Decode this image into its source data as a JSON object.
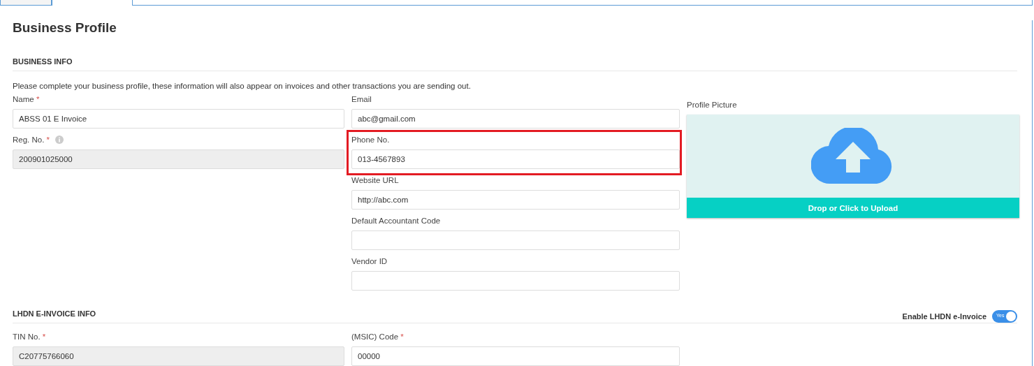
{
  "tabs": [
    {
      "selected": false
    },
    {
      "selected": true
    }
  ],
  "title": "Business Profile",
  "business_info": {
    "heading": "BUSINESS INFO",
    "description": "Please complete your business profile, these information will also appear on invoices and other transactions you are sending out.",
    "columns": [
      [
        {
          "label": "Name",
          "required_mark": "*",
          "value": "ABSS 01 E Invoice",
          "disabled": false
        },
        {
          "label": "Reg. No.",
          "required_mark": "*",
          "info": true,
          "value": "200901025000",
          "disabled": true
        }
      ],
      [
        {
          "label": "Email",
          "value": "abc@gmail.com",
          "disabled": false
        },
        {
          "label": "Phone No.",
          "value": "013-4567893",
          "disabled": false,
          "highlighted": true
        },
        {
          "label": "Website URL",
          "value": "http://abc.com",
          "disabled": false
        },
        {
          "label": "Default Accountant Code",
          "disabled": false
        },
        {
          "label": "Vendor ID",
          "disabled": false
        }
      ]
    ],
    "profile_picture": {
      "label": "Profile Picture",
      "upload_label": "Drop or Click to Upload"
    }
  },
  "lhdn_info": {
    "heading": "LHDN E-INVOICE INFO",
    "toggle": {
      "label": "Enable LHDN e-Invoice",
      "on": true,
      "state_text": "Yes"
    },
    "columns": [
      [
        {
          "label": "TIN No.",
          "required_mark": "*",
          "value": "C20775766060",
          "disabled": true
        }
      ],
      [
        {
          "label": "(MSIC) Code",
          "required_mark": "*",
          "value": "00000",
          "disabled": false
        }
      ]
    ]
  }
}
